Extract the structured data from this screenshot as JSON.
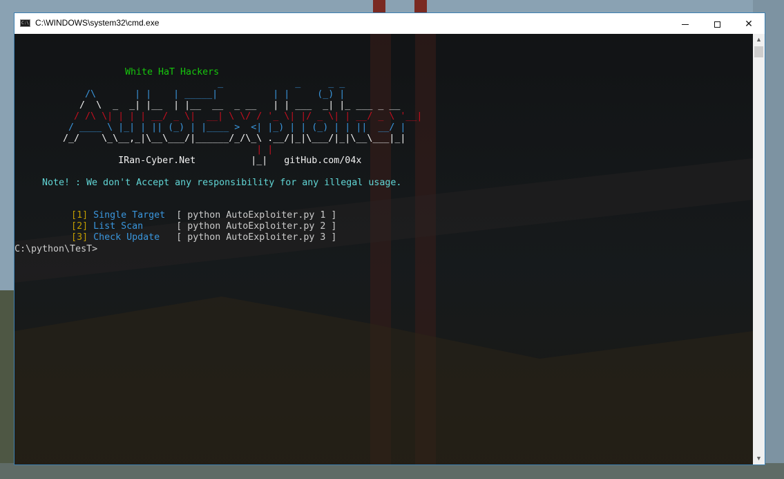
{
  "window": {
    "title": "C:\\WINDOWS\\system32\\cmd.exe",
    "icon_label": "C:\\",
    "minimize_icon": "minimize-icon",
    "maximize_icon": "maximize-icon",
    "close_glyph": "✕"
  },
  "console": {
    "tagline": "White HaT Hackers",
    "banner": [
      "                                  _             _     _ _",
      "          /\\       | |    | _____|          | |     (_) |",
      "         /  \\  _  _| |__  | |__  __  _ __   | | ___  _| |_ ___ _ __",
      "        / /\\ \\| | | | __/ _ \\|  __| \\ \\/ / '_ \\| |/ _ \\| | __/ _ \\ '__|",
      "       / ____ \\ |_| | || (_) | |____ >  <| |_) | | (_) | | ||  __/ |",
      "      /_/    \\_\\__,_|\\__\\___/|______/_/\\_\\ .__/|_|\\___/|_|\\__\\___|_|",
      "                                         | |",
      "                IRan-Cyber.Net          |_|   gitHub.com/04x"
    ],
    "note": "Note! : We don't Accept any responsibility for any illegal usage.",
    "menu": [
      {
        "num": "1",
        "label": "Single Target",
        "command": "[ python AutoExploiter.py 1 ]"
      },
      {
        "num": "2",
        "label": "List Scan    ",
        "command": "[ python AutoExploiter.py 2 ]"
      },
      {
        "num": "3",
        "label": "Check Update ",
        "command": "[ python AutoExploiter.py 3 ]"
      }
    ],
    "prompt": "C:\\python\\TesT>"
  },
  "scrollbar": {
    "up_icon": "▲",
    "down_icon": "▼"
  },
  "colors": {
    "tagline": "#16c60c",
    "banner_top": "#3a96dd",
    "banner_mid": "#c50f1f",
    "note": "#61d6d6",
    "menu_number": "#c19c00",
    "menu_label": "#3a96dd"
  }
}
